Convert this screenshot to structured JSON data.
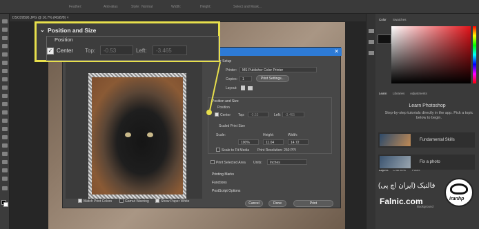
{
  "optbar": {
    "items": [
      "Feather:",
      "Anti-alias",
      "Style:",
      "Normal",
      "Width:",
      "Height:",
      "Select and Mask..."
    ]
  },
  "doc_tab": "DSC09590.JPG @ 16.7% (RGB/8) ×",
  "callout": {
    "title": "Position and Size",
    "section": "Position",
    "center_label": "Center",
    "top_label": "Top:",
    "top_value": "-0.53",
    "left_label": "Left:",
    "left_value": "-3.465"
  },
  "dialog": {
    "printer_setup": "Printer Setup",
    "printer_label": "Printer:",
    "printer_value": "MS Publisher Color Printer",
    "copies_label": "Copies:",
    "copies_value": "1",
    "print_settings": "Print Settings...",
    "layout_label": "Layout:",
    "pos_size": "Position and Size",
    "position": "Position",
    "center_label": "Center",
    "top_label": "Top:",
    "top_value": "-0.53",
    "left_label": "Left:",
    "left_value": "-3.465",
    "scaled_print_size": "Scaled Print Size",
    "scale_label": "Scale:",
    "scale_value": "100%",
    "height_label": "Height:",
    "height_value": "11.04",
    "width_label": "Width:",
    "width_value": "14.72",
    "scale_to_fit": "Scale to Fit Media",
    "print_resolution": "Print Resolution: 250 PPI",
    "print_selected": "Print Selected Area",
    "units_label": "Units:",
    "units_value": "Inches",
    "printing_marks": "Printing Marks",
    "functions": "Functions",
    "postscript": "PostScript Options",
    "match_colors": "Match Print Colors",
    "gamut_warning": "Gamut Warning",
    "show_paper_white": "Show Paper White",
    "cancel": "Cancel",
    "done": "Done",
    "print": "Print"
  },
  "right": {
    "color_tab": "Color",
    "swatches_tab": "Swatches",
    "learn_tab": "Learn",
    "libraries_tab": "Libraries",
    "adjustments_tab": "Adjustments",
    "learn_title": "Learn Photoshop",
    "learn_desc": "Step-by-step tutorials directly in the app. Pick a topic below to begin.",
    "topic1": "Fundamental Skills",
    "topic2": "Fix a photo",
    "layers_tab": "Layers",
    "channels_tab": "Channels",
    "paths_tab": "Paths",
    "background_layer": "Background"
  },
  "brand": {
    "name_fa": "فالنیک (ایران اچ پی)",
    "domain": "Falnic.com",
    "logo_text": "iranhp"
  },
  "colors": {
    "highlight": "#e7df4c",
    "dialog_title": "#2e7bd6"
  }
}
